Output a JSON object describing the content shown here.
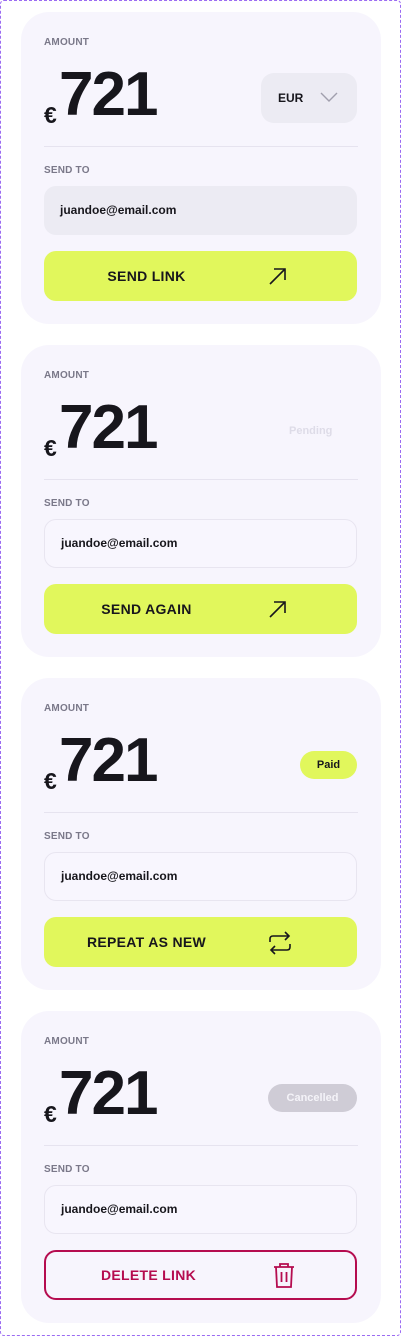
{
  "cards": [
    {
      "amount_label": "AMOUNT",
      "currency_symbol": "€",
      "amount": "721",
      "currency_select": {
        "value": "EUR",
        "icon": "chevron-down-icon"
      },
      "sendto_label": "SEND TO",
      "email": "juandoe@email.com",
      "action": {
        "label": "SEND LINK",
        "icon": "arrow-up-right-icon"
      }
    },
    {
      "amount_label": "AMOUNT",
      "currency_symbol": "€",
      "amount": "721",
      "status": "Pending",
      "sendto_label": "SEND TO",
      "email": "juandoe@email.com",
      "action": {
        "label": "SEND AGAIN",
        "icon": "arrow-up-right-icon"
      }
    },
    {
      "amount_label": "AMOUNT",
      "currency_symbol": "€",
      "amount": "721",
      "status": "Paid",
      "sendto_label": "SEND TO",
      "email": "juandoe@email.com",
      "action": {
        "label": "REPEAT AS NEW",
        "icon": "repeat-icon"
      }
    },
    {
      "amount_label": "AMOUNT",
      "currency_symbol": "€",
      "amount": "721",
      "status": "Cancelled",
      "sendto_label": "SEND TO",
      "email": "juandoe@email.com",
      "action": {
        "label": "DELETE LINK",
        "icon": "trash-icon"
      }
    }
  ],
  "colors": {
    "accent": "#e1f75c",
    "danger": "#b50c4f",
    "card_background": "#f7f5fd",
    "text": "#17161c",
    "muted": "#7a7889"
  }
}
